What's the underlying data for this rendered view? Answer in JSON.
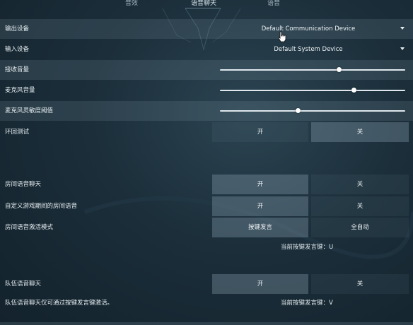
{
  "tabs": [
    {
      "label": "音效",
      "active": false
    },
    {
      "label": "语音聊天",
      "active": true
    },
    {
      "label": "语音",
      "active": false
    }
  ],
  "settings": {
    "output_device": {
      "label": "输出设备",
      "value": "Default Communication Device"
    },
    "input_device": {
      "label": "输入设备",
      "value": "Default System Device"
    },
    "incoming_volume": {
      "label": "接收音量",
      "level": 0.64
    },
    "mic_volume": {
      "label": "麦克风音量",
      "level": 0.72
    },
    "mic_sensitivity": {
      "label": "麦克风灵敏度阈值",
      "level": 0.42
    },
    "loopback_test": {
      "label": "环回测试",
      "on_label": "开",
      "off_label": "关",
      "selected": "off"
    },
    "party_voice_chat": {
      "label": "房间语音聊天",
      "on_label": "开",
      "off_label": "关",
      "selected": "on"
    },
    "custom_game_party_voice": {
      "label": "自定义游戏期间的房间语音",
      "on_label": "开",
      "off_label": "关",
      "selected": "on"
    },
    "party_voice_activation": {
      "label": "房间语音激活模式",
      "ptt_label": "按键发言",
      "auto_label": "全自动",
      "selected": "ptt",
      "keybind_note": "当前按键发言键：U"
    },
    "team_voice_chat": {
      "label": "队伍语音聊天",
      "on_label": "开",
      "off_label": "关",
      "selected": "on",
      "info_note": "队伍语音聊天仅可通过按键发言键激活。",
      "keybind_note": "当前按键发言键：V"
    }
  },
  "icons": {
    "dropdown": "chevron-down-icon",
    "pointer": "hand-cursor-icon"
  }
}
